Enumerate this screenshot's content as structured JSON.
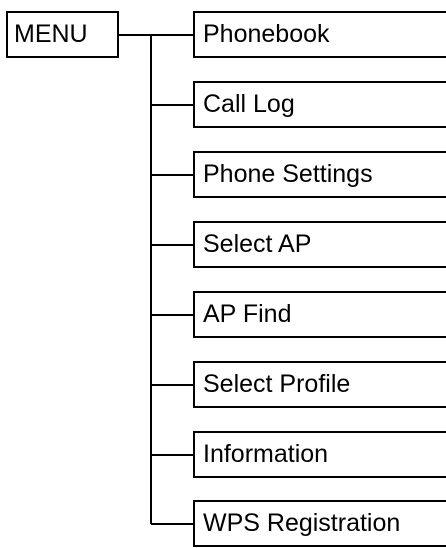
{
  "root": {
    "label": "MENU"
  },
  "items": [
    {
      "label": "Phonebook"
    },
    {
      "label": "Call Log"
    },
    {
      "label": "Phone Settings"
    },
    {
      "label": "Select AP"
    },
    {
      "label": "AP Find"
    },
    {
      "label": "Select Profile"
    },
    {
      "label": "Information"
    },
    {
      "label": "WPS Registration"
    }
  ]
}
